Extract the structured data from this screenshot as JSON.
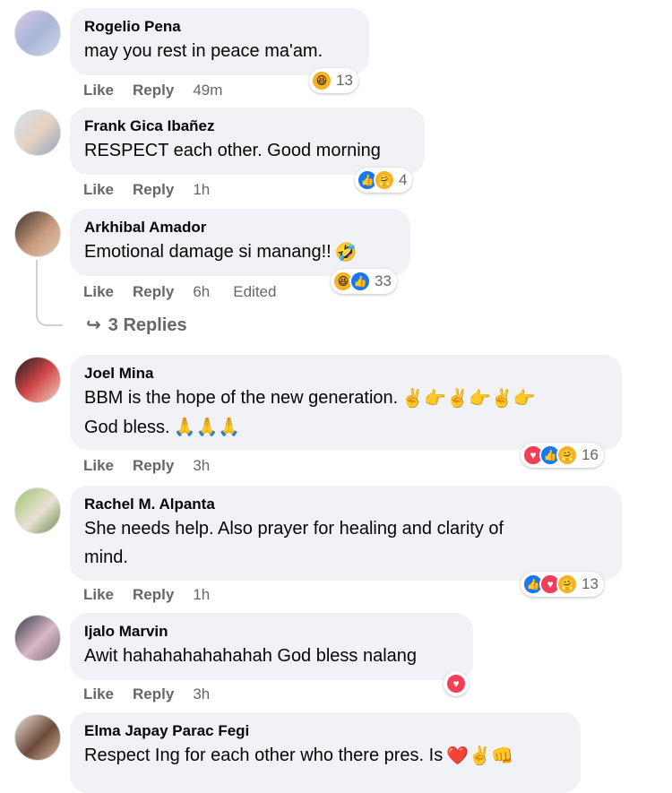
{
  "comments": [
    {
      "author": "Rogelio Pena",
      "lines": [
        "may you rest in peace ma'am."
      ],
      "like": "Like",
      "reply": "Reply",
      "time": "49m",
      "edited": "",
      "reaction_count": "13"
    },
    {
      "author": "Frank Gica Ibañez",
      "lines": [
        "RESPECT each other. Good morning"
      ],
      "like": "Like",
      "reply": "Reply",
      "time": "1h",
      "edited": "",
      "reaction_count": "4"
    },
    {
      "author": "Arkhibal Amador",
      "lines": [
        "Emotional damage si manang!!"
      ],
      "like": "Like",
      "reply": "Reply",
      "time": "6h",
      "edited": "Edited",
      "reaction_count": "33"
    },
    {
      "author": "Joel Mina",
      "lines": [
        "BBM is the hope of the new generation.",
        "God bless."
      ],
      "like": "Like",
      "reply": "Reply",
      "time": "3h",
      "edited": "",
      "reaction_count": "16"
    },
    {
      "author": "Rachel M. Alpanta",
      "lines": [
        "She needs help. Also prayer for healing and clarity of",
        "mind."
      ],
      "like": "Like",
      "reply": "Reply",
      "time": "1h",
      "edited": "",
      "reaction_count": "13"
    },
    {
      "author": "Ijalo Marvin",
      "lines": [
        "Awit hahahahahahahah God bless nalang"
      ],
      "like": "Like",
      "reply": "Reply",
      "time": "3h",
      "edited": "",
      "reaction_count": ""
    },
    {
      "author": "Elma Japay Parac Fegi",
      "lines": [
        "Respect Ing for each other who there pres. Is"
      ],
      "like": "",
      "reply": "",
      "time": "",
      "edited": "",
      "reaction_count": ""
    }
  ],
  "replies_link": "3 Replies",
  "colors": {
    "bubble": "#f0f2f5",
    "like_blue": "#1877f2",
    "love_red": "#f33e58",
    "haha_yellow": "#f7b125",
    "meta_gray": "#65676b"
  }
}
